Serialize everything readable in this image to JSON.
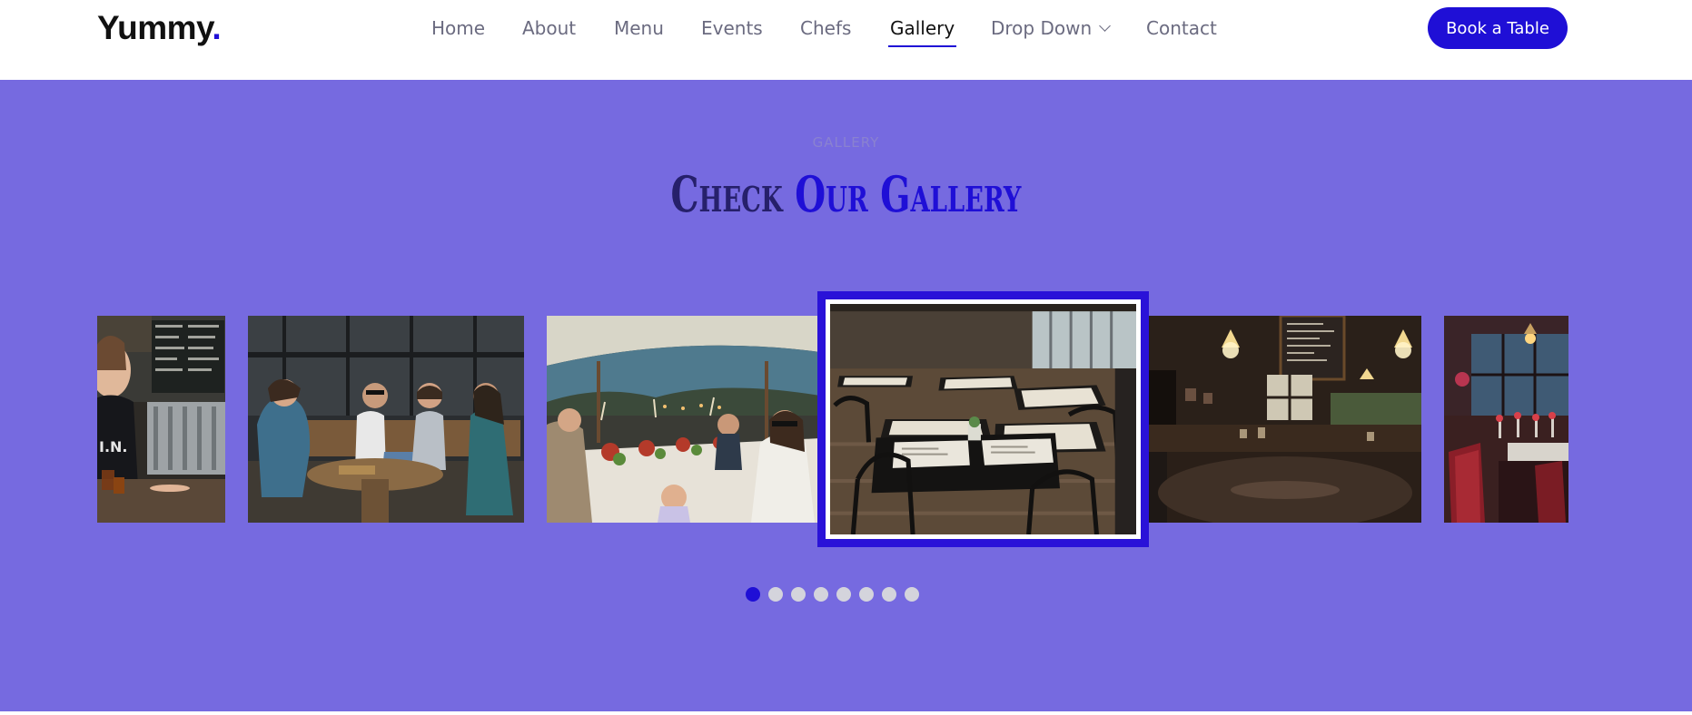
{
  "brand": {
    "name": "Yummy",
    "dot": "."
  },
  "nav": {
    "items": [
      {
        "label": "Home"
      },
      {
        "label": "About"
      },
      {
        "label": "Menu"
      },
      {
        "label": "Events"
      },
      {
        "label": "Chefs"
      },
      {
        "label": "Gallery",
        "active": true
      },
      {
        "label": "Drop Down",
        "has_dropdown": true,
        "icon": "chevron-down-icon"
      },
      {
        "label": "Contact"
      }
    ],
    "cta_label": "Book a Table"
  },
  "gallery": {
    "eyebrow": "GALLERY",
    "title_part1": "Check ",
    "title_part2": "Our Gallery",
    "active_dot": 0,
    "dot_count": 8,
    "slides": [
      {
        "id": "bartender"
      },
      {
        "id": "friends-on-bench"
      },
      {
        "id": "outdoor-dinner-toast"
      },
      {
        "id": "restaurant-tables",
        "active": true
      },
      {
        "id": "cozy-dining-room"
      },
      {
        "id": "red-chairs-dining"
      }
    ]
  },
  "colors": {
    "accent": "#1f0fd6",
    "section_bg": "#766ae0",
    "nav_text": "#6b6b80",
    "title_dark": "#26206b"
  }
}
